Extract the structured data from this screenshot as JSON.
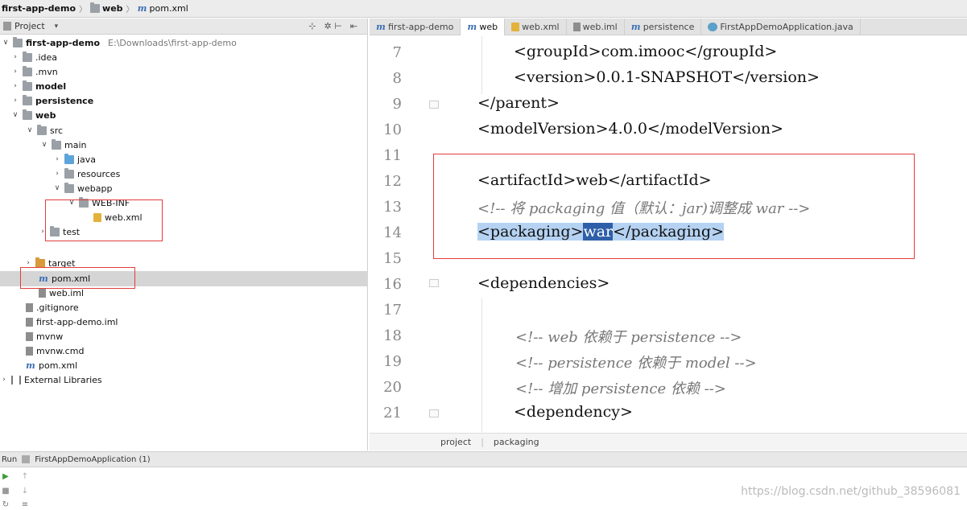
{
  "breadcrumb": [
    "first-app-demo",
    "web",
    "pom.xml"
  ],
  "project_panel": {
    "title": "Project",
    "tree": [
      {
        "label": "first-app-demo",
        "path": "E:\\Downloads\\first-app-demo",
        "bold": true
      },
      {
        "label": ".idea"
      },
      {
        "label": ".mvn"
      },
      {
        "label": "model",
        "bold": true
      },
      {
        "label": "persistence",
        "bold": true
      },
      {
        "label": "web",
        "bold": true
      },
      {
        "label": "src"
      },
      {
        "label": "main"
      },
      {
        "label": "java"
      },
      {
        "label": "resources"
      },
      {
        "label": "webapp"
      },
      {
        "label": "WEB-INF"
      },
      {
        "label": "web.xml"
      },
      {
        "label": "test"
      },
      {
        "label": "target"
      },
      {
        "label": "pom.xml"
      },
      {
        "label": "web.iml"
      },
      {
        "label": ".gitignore"
      },
      {
        "label": "first-app-demo.iml"
      },
      {
        "label": "mvnw"
      },
      {
        "label": "mvnw.cmd"
      },
      {
        "label": "pom.xml"
      },
      {
        "label": "External Libraries"
      }
    ]
  },
  "tabs": [
    {
      "label": "first-app-demo"
    },
    {
      "label": "web"
    },
    {
      "label": "web.xml"
    },
    {
      "label": "web.iml"
    },
    {
      "label": "persistence"
    },
    {
      "label": "FirstAppDemoApplication.java"
    }
  ],
  "editor": {
    "line_numbers": [
      "7",
      "8",
      "9",
      "10",
      "11",
      "12",
      "13",
      "14",
      "15",
      "16",
      "17",
      "18",
      "19",
      "20",
      "21"
    ],
    "lines": [
      "<groupId>com.imooc</groupId>",
      "<version>0.0.1-SNAPSHOT</version>",
      "</parent>",
      "<modelVersion>4.0.0</modelVersion>",
      "",
      "<artifactId>web</artifactId>",
      "<!-- 将 packaging 值（默认：jar)调整成 war -->",
      "",
      "",
      "<dependencies>",
      "",
      "<!-- web 依赖于 persistence -->",
      "<!-- persistence 依赖于 model -->",
      "<!-- 增加 persistence 依赖 -->",
      "<dependency>"
    ],
    "line14": {
      "open": "<packaging>",
      "value": "war",
      "close": "</packaging>"
    }
  },
  "status_breadcrumb": [
    "project",
    "packaging"
  ],
  "run": {
    "label": "Run",
    "config": "FirstAppDemoApplication (1)"
  },
  "watermark": "https://blog.csdn.net/github_38596081",
  "colors": {
    "highlight_box": "#e23c3c",
    "selection": "#b5d2f2",
    "selected_word": "#2f5fa8"
  }
}
